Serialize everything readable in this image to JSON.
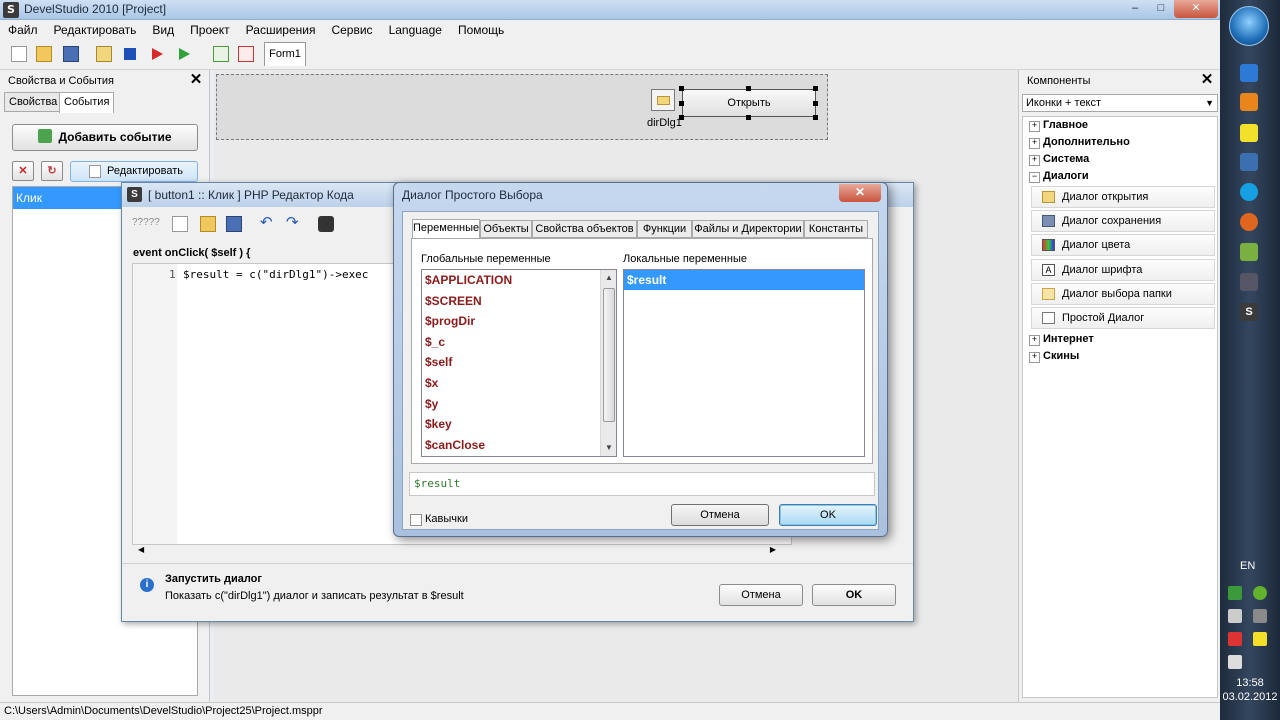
{
  "window": {
    "title": "DevelStudio 2010 [Project]"
  },
  "menu": [
    "Файл",
    "Редактировать",
    "Вид",
    "Проект",
    "Расширения",
    "Сервис",
    "Language",
    "Помощь"
  ],
  "doc_tab": "Form1",
  "left_panel": {
    "title": "Свойства и События",
    "tabs": [
      "Свойства",
      "События"
    ],
    "add_event": "Добавить событие",
    "edit": "Редактировать",
    "events": [
      "Клик"
    ]
  },
  "form_design": {
    "dir_component_label": "dirDlg1",
    "button_caption": "Открыть"
  },
  "right_panel": {
    "title": "Компоненты",
    "view_mode": "Иконки + текст",
    "categories": [
      "Главное",
      "Дополнительно",
      "Система",
      "Диалоги",
      "Интернет",
      "Скины"
    ],
    "dialog_items": [
      "Диалог открытия",
      "Диалог сохранения",
      "Диалог цвета",
      "Диалог шрифта",
      "Диалог выбора папки",
      "Простой Диалог"
    ]
  },
  "status_path": "C:\\Users\\Admin\\Documents\\DevelStudio\\Project25\\Project.msppr",
  "editor": {
    "title": "[ button1 :: Клик ] PHP Редактор Кода",
    "toolbar_placeholder": "?????",
    "signature": "event onClick( $self ) {",
    "line_number": "1",
    "code_line": "$result = c(\"dirDlg1\")->exec",
    "help_title": "Запустить диалог",
    "help_text": "Показать c(\"dirDlg1\") диалог и записать результат в $result",
    "cancel": "Отмена",
    "ok": "OK"
  },
  "dialog": {
    "title": "Диалог Простого Выбора",
    "tabs": [
      "Переменные",
      "Объекты",
      "Свойства объектов",
      "Функции",
      "Файлы и Директории",
      "Константы"
    ],
    "global_label": "Глобальные переменные",
    "local_label": "Локальные переменные",
    "globals": [
      "$APPLICATION",
      "$SCREEN",
      "$progDir",
      "$_c",
      "$self",
      "$x",
      "$y",
      "$key",
      "$canClose"
    ],
    "locals": [
      "$result"
    ],
    "result_value": "$result",
    "quotes_label": "Кавычки",
    "cancel": "Отмена",
    "ok": "OK"
  },
  "tray": {
    "lang": "EN",
    "time": "13:58",
    "date": "03.02.2012"
  }
}
